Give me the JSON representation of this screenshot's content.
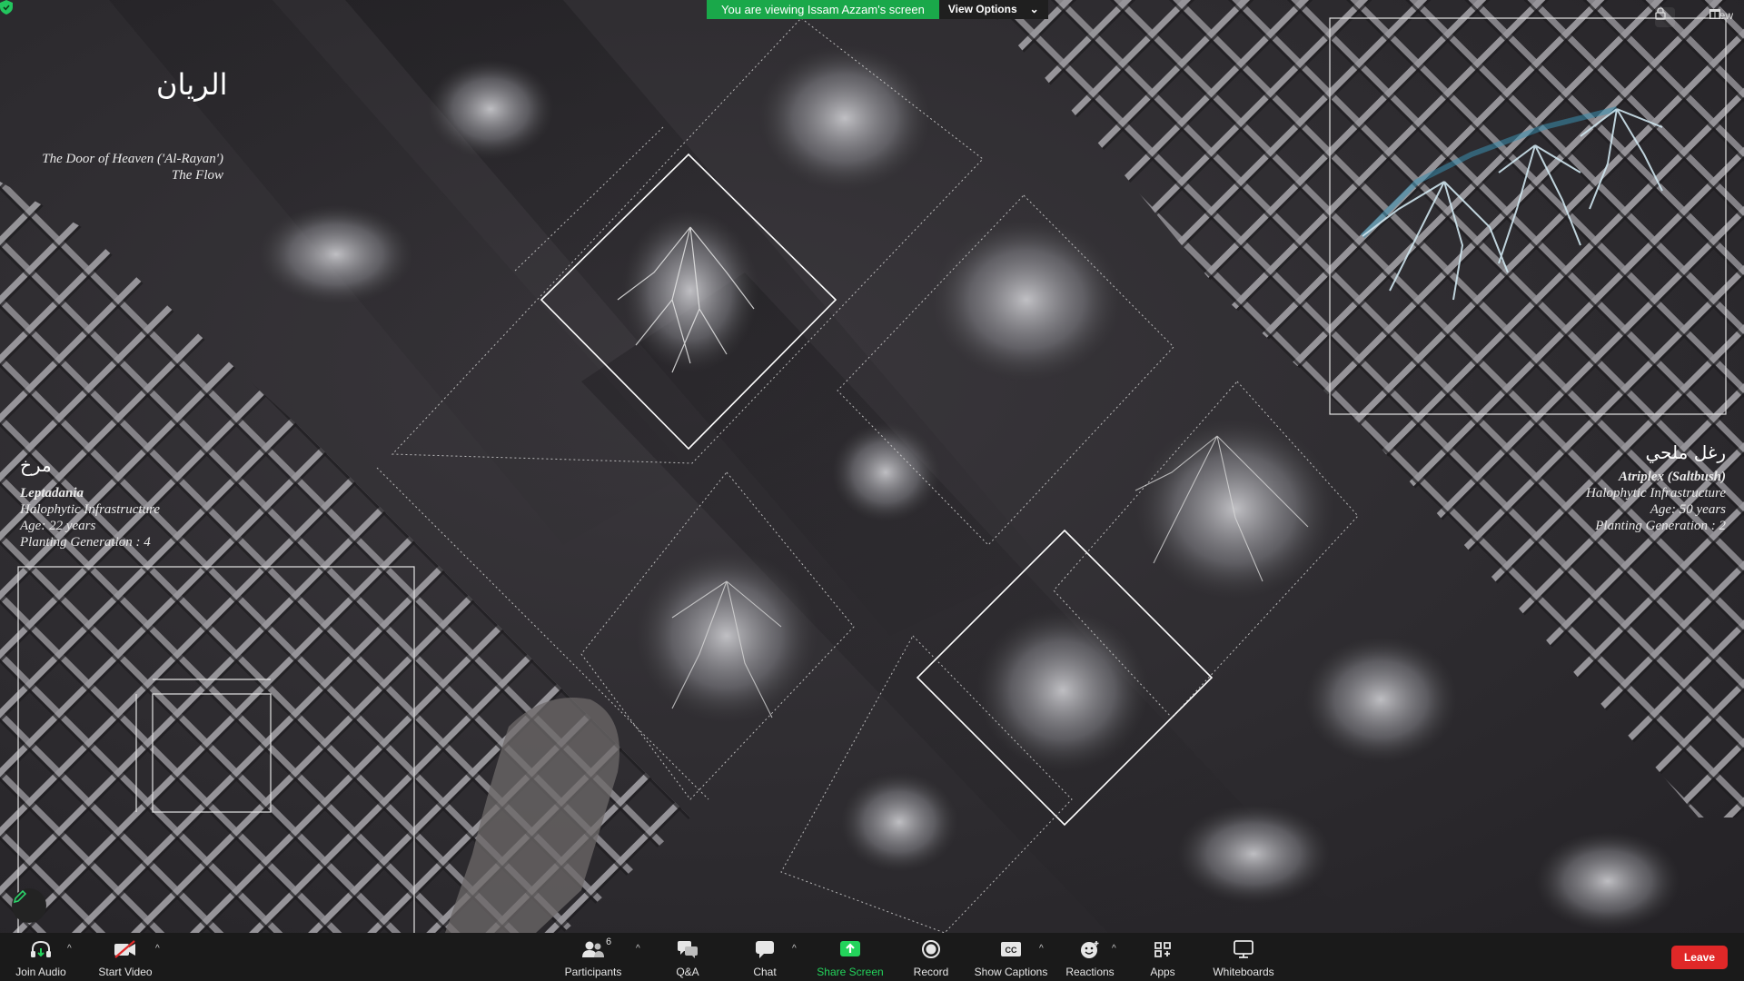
{
  "banner": {
    "viewing_text": "You are viewing Issam Azzam's screen",
    "view_options_label": "View Options"
  },
  "corner": {
    "view_label": "View"
  },
  "slide": {
    "title_arabic": "الريان",
    "subtitle_line1": "The Door of Heaven ('Al-Rayan')",
    "subtitle_line2": "The Flow",
    "left_plant": {
      "name_arabic": "مرخ",
      "name": "Leptadania",
      "type": "Halophytic Infrastructure",
      "age": "Age: 22 years",
      "generation": "Planting Generation : 4"
    },
    "right_plant": {
      "name_arabic": "رغل ملحي",
      "name": "Atriplex (Saltbush)",
      "type": "Halophytic Infrastructure",
      "age": "Age: 50 years",
      "generation": "Planting Generation : 2"
    }
  },
  "toolbar": {
    "join_audio": "Join Audio",
    "start_video": "Start Video",
    "participants": "Participants",
    "participants_count": "6",
    "qa": "Q&A",
    "chat": "Chat",
    "share_screen": "Share Screen",
    "record": "Record",
    "show_captions": "Show Captions",
    "reactions": "Reactions",
    "apps": "Apps",
    "whiteboards": "Whiteboards",
    "leave": "Leave"
  },
  "colors": {
    "banner_green": "#1aa84a",
    "share_green": "#23d35b",
    "leave_red": "#e02828",
    "toolbar_bg": "#1a1a1a",
    "root_blue": "#3b8fb0"
  }
}
